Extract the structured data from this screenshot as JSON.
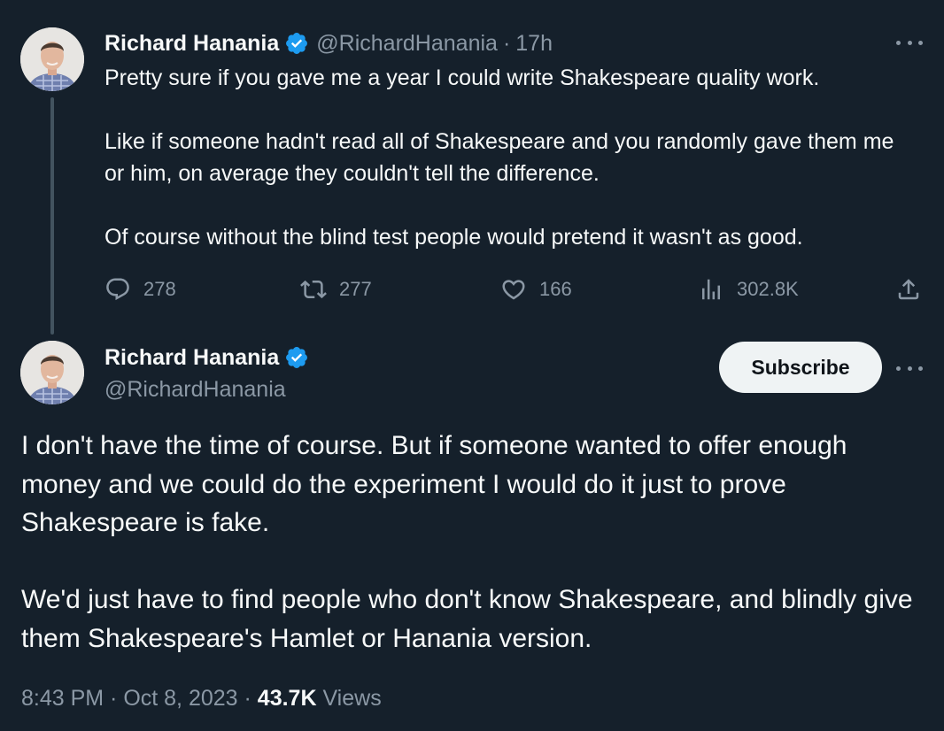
{
  "tweet1": {
    "author_name": "Richard Hanania",
    "handle": "@RichardHanania",
    "separator": "·",
    "time": "17h",
    "paragraphs": [
      "Pretty sure if you gave me a year I could write Shakespeare quality work.",
      "Like if someone hadn't read all of Shakespeare and you randomly gave them me or him, on average they couldn't tell the difference.",
      "Of course without the blind test people would pretend it wasn't as good."
    ],
    "replies": "278",
    "reposts": "277",
    "likes": "166",
    "views": "302.8K"
  },
  "tweet2": {
    "author_name": "Richard Hanania",
    "handle": "@RichardHanania",
    "subscribe_label": "Subscribe",
    "paragraphs": [
      "I don't have the time of course. But if someone wanted to offer enough money and we could do the experiment I would do it just to prove Shakespeare is fake.",
      "We'd just have to find people who don't know Shakespeare, and blindly give them Shakespeare's Hamlet or Hanania version."
    ],
    "timestamp": "8:43 PM · Oct 8, 2023 · ",
    "views_count": "43.7K",
    "views_label": " Views"
  },
  "icons": {
    "verified": "verified-badge-icon",
    "reply": "reply-icon",
    "repost": "repost-icon",
    "like": "heart-icon",
    "views": "views-icon",
    "share": "share-icon",
    "more": "more-icon"
  },
  "colors": {
    "background": "#15202b",
    "text": "#f7f9f9",
    "secondary": "#8b98a5",
    "verified": "#1d9bf0"
  }
}
